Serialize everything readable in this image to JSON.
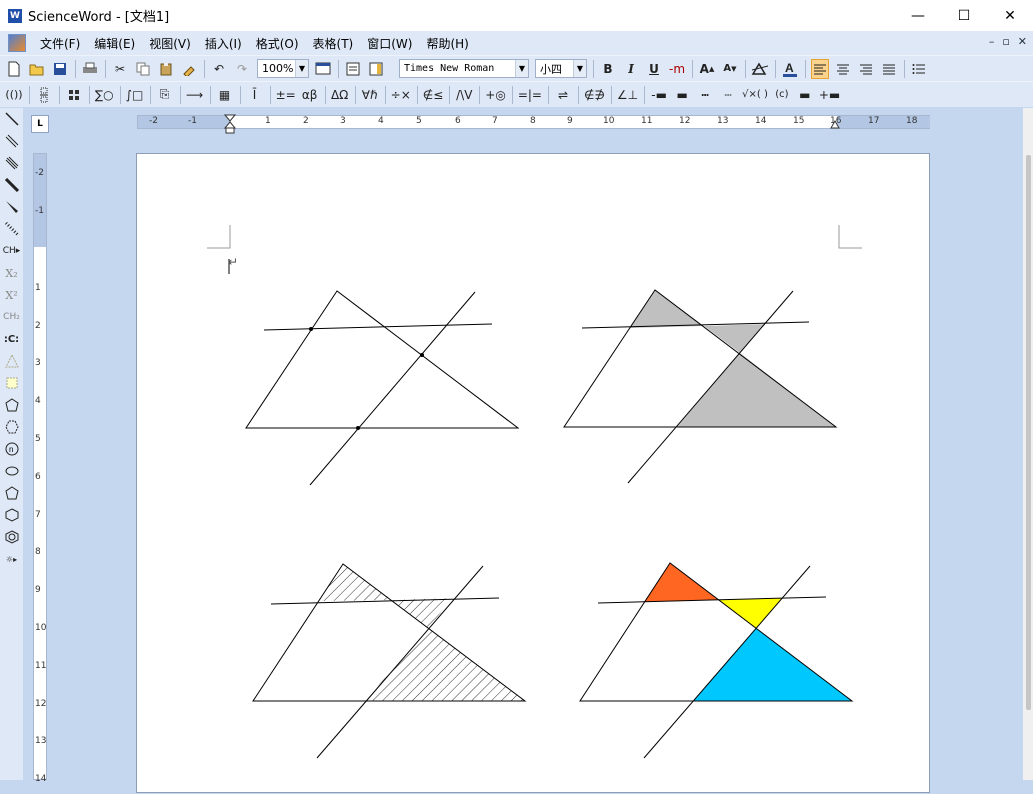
{
  "window": {
    "title": "ScienceWord - [文档1]",
    "minimize": "—",
    "maximize": "☐",
    "close": "✕"
  },
  "menu": {
    "items": [
      "文件(F)",
      "编辑(E)",
      "视图(V)",
      "插入(I)",
      "格式(O)",
      "表格(T)",
      "窗口(W)",
      "帮助(H)"
    ],
    "mdi_controls": [
      "–",
      "▫",
      "✕"
    ]
  },
  "toolbar1": {
    "zoom": "100%",
    "font": "Times New Roman",
    "size": "小四",
    "bold": "B",
    "italic": "I",
    "underline": "U",
    "strike": "-m"
  },
  "toolbar2": {
    "labels": [
      "(())",
      "∑○",
      "∫□",
      "±=",
      "αβ",
      "ΔΩ",
      "∀ℏ",
      "÷×",
      "∉≤",
      "/\\V",
      "+◎",
      "=|=",
      "⇌",
      "∉∌",
      "∠⊥",
      "√×( )",
      "(c)"
    ]
  },
  "left_tools": [
    "X₂",
    "X²",
    "CH₂",
    ":C:"
  ],
  "ruler": {
    "h_ticks": [
      "-2",
      "-1",
      "1",
      "2",
      "3",
      "4",
      "5",
      "6",
      "7",
      "8",
      "9",
      "10",
      "11",
      "12",
      "13",
      "14",
      "15",
      "16",
      "17",
      "18"
    ],
    "v_ticks": [
      "-2",
      "-1",
      "1",
      "2",
      "3",
      "4",
      "5",
      "6",
      "7",
      "8",
      "9",
      "10",
      "11",
      "12",
      "13",
      "14"
    ]
  },
  "document": {
    "paragraph_mark": "↵"
  },
  "colors": {
    "gray_fill": "#c0c0c0",
    "orange_fill": "#ff6622",
    "yellow_fill": "#ffff00",
    "cyan_fill": "#00c8ff"
  }
}
